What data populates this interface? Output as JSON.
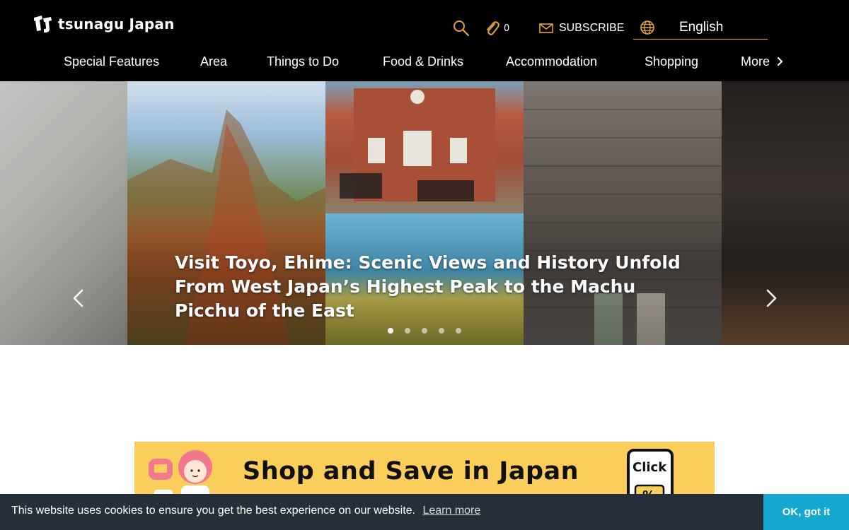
{
  "header": {
    "logo_text": "tsunagu Japan",
    "clip_count": "0",
    "subscribe_label": "SUBSCRIBE",
    "language_label": "English",
    "icon_color": "#e3a33c"
  },
  "nav": {
    "items": [
      {
        "label": "Special Features"
      },
      {
        "label": "Area"
      },
      {
        "label": "Things to Do"
      },
      {
        "label": "Food & Drinks"
      },
      {
        "label": "Accommodation"
      },
      {
        "label": "Shopping"
      },
      {
        "label": "More"
      }
    ]
  },
  "hero": {
    "title": "Visit Toyo, Ehime: Scenic Views and History Unfold From West Japan’s Highest Peak to the Machu Picchu of the East",
    "slide_count": 5,
    "active_slide": 1
  },
  "banner": {
    "text": "Shop and Save in Japan",
    "phone_label": "Click",
    "phone_symbol": "%"
  },
  "cookie": {
    "message": "This website uses cookies to ensure you get the best experience on our website.",
    "link_label": "Learn more",
    "button_label": "OK, got it",
    "button_color": "#14a7d0"
  }
}
